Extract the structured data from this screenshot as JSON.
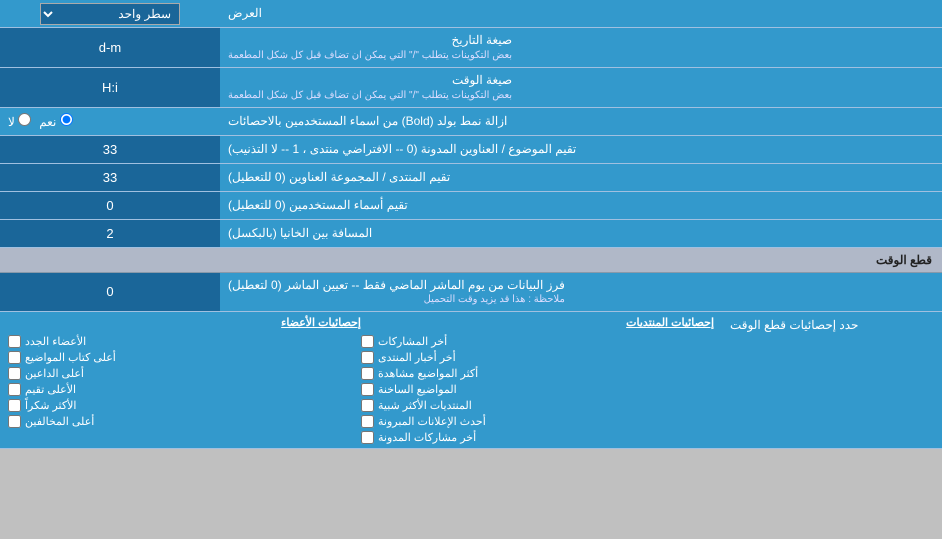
{
  "page": {
    "title": "العرض"
  },
  "rows": [
    {
      "id": "display-type",
      "label": "العرض",
      "input_type": "dropdown",
      "value": "سطر واحد"
    },
    {
      "id": "date-format",
      "label": "صيغة التاريخ",
      "sublabel": "بعض التكوينات يتطلب \"/\" التي يمكن ان تضاف قبل كل شكل المطعمة",
      "input_type": "text",
      "value": "d-m"
    },
    {
      "id": "time-format",
      "label": "صيغة الوقت",
      "sublabel": "بعض التكوينات يتطلب \"/\" التي يمكن ان تضاف قبل كل شكل المطعمة",
      "input_type": "text",
      "value": "H:i"
    },
    {
      "id": "bold-remove",
      "label": "ازالة نمط بولد (Bold) من اسماء المستخدمين بالاحصائات",
      "input_type": "radio",
      "options": [
        "نعم",
        "لا"
      ],
      "selected": "نعم"
    },
    {
      "id": "topic-sort",
      "label": "تقيم الموضوع / العناوين المدونة (0 -- الافتراضي منتدى ، 1 -- لا التذنيب)",
      "input_type": "text",
      "value": "33"
    },
    {
      "id": "forum-sort",
      "label": "تقيم المنتدى / المجموعة العناوين (0 للتعطيل)",
      "input_type": "text",
      "value": "33"
    },
    {
      "id": "users-sort",
      "label": "تقيم أسماء المستخدمين (0 للتعطيل)",
      "input_type": "text",
      "value": "0"
    },
    {
      "id": "gap",
      "label": "المسافة بين الخانيا (بالبكسل)",
      "input_type": "text",
      "value": "2"
    }
  ],
  "section_time": {
    "label": "قطع الوقت"
  },
  "time_cut_row": {
    "label": "فرز البيانات من يوم الماشر الماضي فقط -- تعيين الماشر (0 لتعطيل)",
    "note": "ملاحظة : هذا قد يزيد وقت التحميل",
    "value": "0"
  },
  "stats_section": {
    "label": "حدد إحصائيات قطع الوقت",
    "col1_header": "إحصائيات المنتديات",
    "col2_header": "إحصائيات الأعضاء",
    "col1_items": [
      "أخر المشاركات",
      "أخر أخبار المنتدى",
      "أكثر المواضيع مشاهدة",
      "المواضيع الساخنة",
      "المنتديات الأكثر شبية",
      "أحدث الإعلانات المبرونة",
      "أخر مشاركات المدونة"
    ],
    "col2_items": [
      "الأعضاء الجدد",
      "أعلى كتاب المواضيع",
      "أعلى الداعين",
      "الأعلى تقيم",
      "الأكثر شكراً",
      "أعلى المخالفين"
    ]
  }
}
